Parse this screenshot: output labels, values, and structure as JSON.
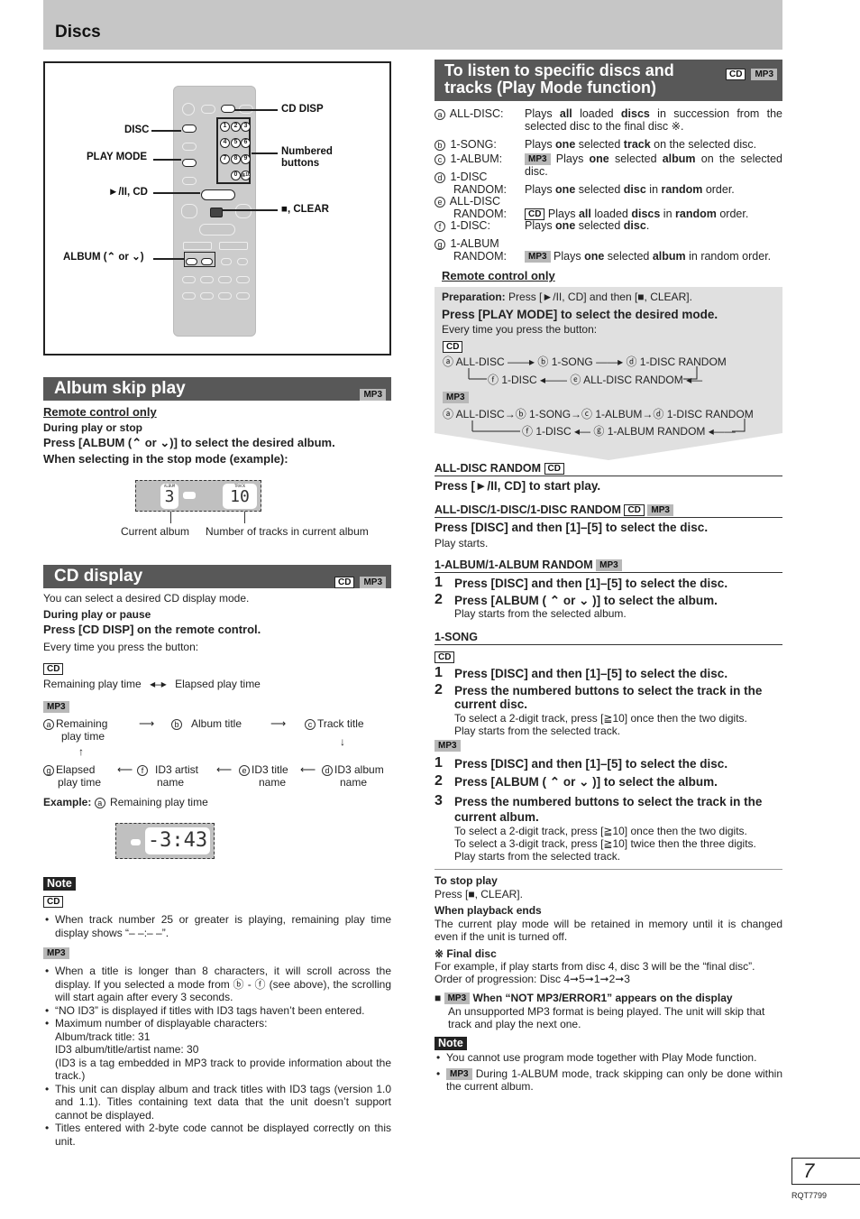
{
  "page_header": {
    "title": "Discs"
  },
  "remote_figure": {
    "labels": {
      "cd_disp": "CD DISP",
      "disc": "DISC",
      "play_mode": "PLAY MODE",
      "numbered_buttons_1": "Numbered",
      "numbered_buttons_2": "buttons",
      "play_pause_cd": "►/II, CD",
      "stop_clear": "■, CLEAR",
      "album": "ALBUM (⌃ or ⌄)"
    },
    "numbers": [
      "1",
      "2",
      "3",
      "4",
      "5",
      "6",
      "7",
      "8",
      "9",
      "0",
      "≧10"
    ]
  },
  "album_skip": {
    "title": "Album skip play",
    "tag": "MP3",
    "remote_only": "Remote control only",
    "when": "During play or stop",
    "instruction": "Press [ALBUM (⌃ or ⌄)] to select the desired album.",
    "stop_mode": "When selecting in the stop mode (example):",
    "display_album_label": "ALBUM",
    "display_album_value": "3",
    "display_track_label": "TRACK",
    "display_track_value": "10",
    "caption_current": "Current album",
    "caption_tracks": "Number of tracks in current album"
  },
  "cd_display": {
    "title": "CD display",
    "tags": [
      "CD",
      "MP3"
    ],
    "intro": "You can select a desired CD display mode.",
    "when": "During play or pause",
    "instruction": "Press [CD DISP] on the remote control.",
    "every_time": "Every time you press the button:",
    "cd_tag": "CD",
    "cd_remaining": "Remaining play time",
    "cd_elapsed": "Elapsed play time",
    "mp3_tag": "MP3",
    "mp3_cycle": {
      "a": {
        "mark": "a",
        "l1": "Remaining",
        "l2": "play time"
      },
      "b": {
        "mark": "b",
        "l1": "Album title"
      },
      "c": {
        "mark": "c",
        "l1": "Track title"
      },
      "d": {
        "mark": "d",
        "l1": "ID3 album",
        "l2": "name"
      },
      "e": {
        "mark": "e",
        "l1": "ID3 title",
        "l2": "name"
      },
      "f": {
        "mark": "f",
        "l1": "ID3 artist",
        "l2": "name"
      },
      "g": {
        "mark": "g",
        "l1": "Elapsed",
        "l2": "play time"
      }
    },
    "example_label": "Example:",
    "example_mark": "a",
    "example_text": "Remaining play time",
    "example_display": "-3:43",
    "note_label": "Note",
    "note_cd_tag": "CD",
    "note_cd_items": [
      "When track number 25 or greater is playing, remaining play time display shows “– –:– –”."
    ],
    "note_mp3_tag": "MP3",
    "note_mp3_items": [
      "When a title is longer than 8 characters, it will scroll across the display. If you selected a mode from ⓑ - ⓕ (see above), the scrolling will start again after every 3 seconds.",
      "“NO ID3” is displayed if titles with ID3 tags haven’t been entered.",
      "Maximum number of displayable characters:",
      "This unit can display album and track titles with ID3 tags (version 1.0 and 1.1). Titles containing text data that the unit doesn’t support cannot be displayed.",
      "Titles entered with 2-byte code cannot be displayed correctly on this unit."
    ],
    "max_chars": [
      "Album/track title: 31",
      "ID3 album/title/artist name: 30",
      "(ID3 is a tag embedded in MP3 track to provide information about the track.)"
    ]
  },
  "play_mode": {
    "title_1": "To listen to specific discs and",
    "title_2": "tracks (Play Mode function)",
    "tags": [
      "CD",
      "MP3"
    ],
    "modes": [
      {
        "mark": "a",
        "name": "ALL-DISC:",
        "desc": "Plays <b>all</b> loaded <b>discs</b> in succession from the selected disc to the final disc ※."
      },
      {
        "mark": "b",
        "name": "1-SONG:",
        "desc": "Plays <b>one</b> selected <b>track</b> on the selected disc."
      },
      {
        "mark": "c",
        "name": "1-ALBUM:",
        "tag": "MP3",
        "desc": "Plays <b>one</b> selected <b>album</b> on the selected disc."
      },
      {
        "mark": "d",
        "name": "1-DISC RANDOM:",
        "desc": "Plays <b>one</b> selected <b>disc</b> in <b>random</b> order."
      },
      {
        "mark": "e",
        "name": "ALL-DISC RANDOM:",
        "tag": "CD",
        "desc": "Plays <b>all</b> loaded <b>discs</b> in <b>random</b> order."
      },
      {
        "mark": "f",
        "name": "1-DISC:",
        "desc": "Plays <b>one</b> selected <b>disc</b>."
      },
      {
        "mark": "g",
        "name": "1-ALBUM RANDOM:",
        "tag": "MP3",
        "desc": "Plays <b>one</b> selected <b>album</b> in random order."
      }
    ],
    "remote_only": "Remote control only",
    "prep_label": "Preparation:",
    "prep_text": "Press [►/II, CD] and then [■, CLEAR].",
    "press_play_mode": "Press [PLAY MODE] to select the desired mode.",
    "every_time": "Every time you press the button:",
    "cd_tag": "CD",
    "cd_flow_top": [
      "ⓐ ALL-DISC",
      "ⓑ 1-SONG",
      "ⓓ 1-DISC RANDOM"
    ],
    "cd_flow_bottom": [
      "ⓕ 1-DISC",
      "ⓔ ALL-DISC RANDOM"
    ],
    "mp3_tag": "MP3",
    "mp3_flow_top": [
      "ⓐ ALL-DISC",
      "ⓑ 1-SONG",
      "ⓒ 1-ALBUM",
      "ⓓ 1-DISC RANDOM"
    ],
    "mp3_flow_bottom": [
      "ⓕ 1-DISC",
      "ⓖ 1-ALBUM RANDOM"
    ],
    "all_disc_random_head": "ALL-DISC RANDOM",
    "all_disc_random_tag": "CD",
    "all_disc_random_step": "Press [►/II, CD] to start play.",
    "multi_head": "ALL-DISC/1-DISC/1-DISC RANDOM",
    "multi_tags": [
      "CD",
      "MP3"
    ],
    "multi_step": "Press [DISC] and then [1]–[5] to select the disc.",
    "multi_sub": "Play starts.",
    "album_head": "1-ALBUM/1-ALBUM RANDOM",
    "album_tag": "MP3",
    "album_steps": [
      {
        "n": "1",
        "text": "Press [DISC] and then [1]–[5] to select the disc."
      },
      {
        "n": "2",
        "text": "Press [ALBUM ( ⌃ or ⌄ )] to select the album.",
        "sub": "Play starts from the selected album."
      }
    ],
    "song_head": "1-SONG",
    "song_cd_tag": "CD",
    "song_cd_steps": [
      {
        "n": "1",
        "text": "Press [DISC] and then [1]–[5] to select the disc."
      },
      {
        "n": "2",
        "text": "Press the numbered buttons to select the track in the current disc.",
        "sub1": "To select a 2-digit track, press [≧10] once then the two digits.",
        "sub2": "Play starts from the selected track."
      }
    ],
    "song_mp3_tag": "MP3",
    "song_mp3_steps": [
      {
        "n": "1",
        "text": "Press [DISC] and then [1]–[5] to select the disc."
      },
      {
        "n": "2",
        "text": "Press [ALBUM ( ⌃ or ⌄ )] to select the album."
      },
      {
        "n": "3",
        "text": "Press the numbered buttons to select the track in the current album.",
        "sub1": "To select a 2-digit track, press [≧10] once then the two digits.",
        "sub2": "To select a 3-digit track, press [≧10] twice then the three digits.",
        "sub3": "Play starts from the selected track."
      }
    ],
    "stop_head": "To stop play",
    "stop_text": "Press [■, CLEAR].",
    "ends_head": "When playback ends",
    "ends_text": "The current play mode will be retained in memory until it is changed even if the unit is turned off.",
    "final_head": "※ Final disc",
    "final_text1": "For example, if play starts from disc 4, disc 3 will be the “final disc”.",
    "final_text2": "Order of progression: Disc 4➞5➞1➞2➞3",
    "error_tag": "MP3",
    "error_head": "When “NOT MP3/ERROR1” appears on the display",
    "error_text": "An unsupported MP3 format is being played. The unit will skip that track and play the next one.",
    "note_label": "Note",
    "notes": [
      "You cannot use program mode together with Play Mode function.",
      "During 1-ALBUM mode, track skipping can only be done within the current album."
    ],
    "note2_tag": "MP3"
  },
  "footer": {
    "page_number": "7",
    "code": "RQT7799"
  }
}
